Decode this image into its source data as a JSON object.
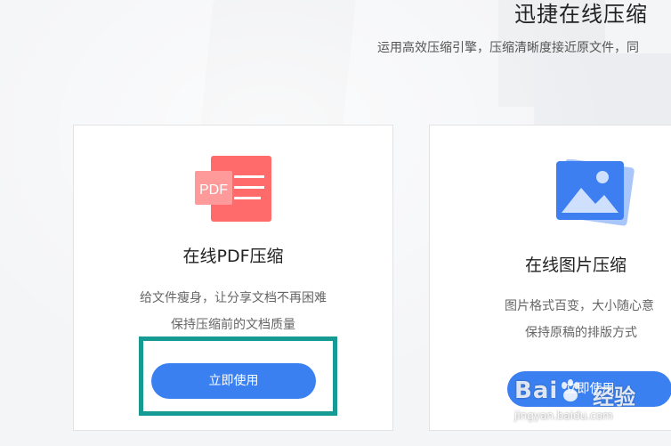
{
  "hero": {
    "title": "迅捷在线压缩",
    "subtitle": "运用高效压缩引擎，压缩清晰度接近原文件，同"
  },
  "cards": [
    {
      "title": "在线PDF压缩",
      "icon_text": "PDF",
      "desc_line1": "给文件瘦身，让分享文档不再困难",
      "desc_line2": "保持压缩前的文档质量",
      "button_label": "立即使用"
    },
    {
      "title": "在线图片压缩",
      "desc_line1": "图片格式百变，大小随心意",
      "desc_line2": "保持原稿的排版方式",
      "button_label": "立即使用"
    }
  ],
  "watermark": {
    "brand_left": "Bai",
    "brand_right": "经验",
    "url": "jingyan.baidu.com"
  },
  "colors": {
    "accent_blue": "#3b80f0",
    "pdf_red": "#ff6b6b",
    "highlight_teal": "#169b94",
    "image_icon_blue": "#3d7ef0"
  }
}
